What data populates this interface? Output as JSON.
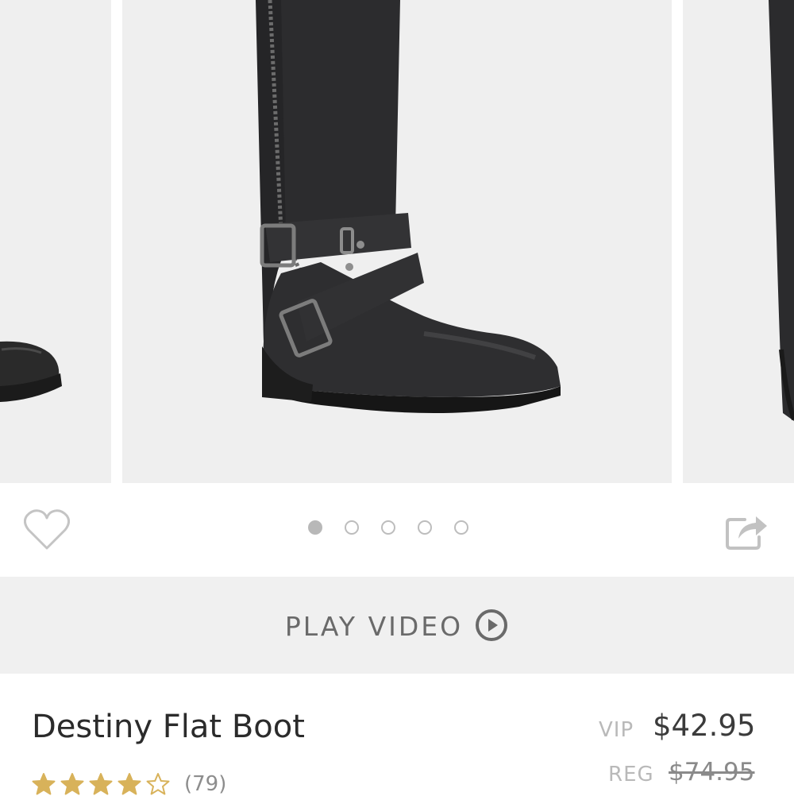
{
  "carousel": {
    "slide_count": 5,
    "active_index": 0
  },
  "video": {
    "label": "PLAY VIDEO"
  },
  "product": {
    "name": "Destiny Flat Boot",
    "vip_label": "VIP",
    "vip_price": "$42.95",
    "reg_label": "REG",
    "reg_price": "$74.95",
    "rating": 4,
    "rating_max": 5,
    "review_count": "(79)"
  },
  "colors": {
    "star_gold": "#d8b25a",
    "image_background": "#efefef",
    "video_bar_background": "#f0f0f0"
  },
  "icons": {
    "favorite": "heart-icon",
    "share": "share-icon",
    "play": "play-circle-icon"
  }
}
